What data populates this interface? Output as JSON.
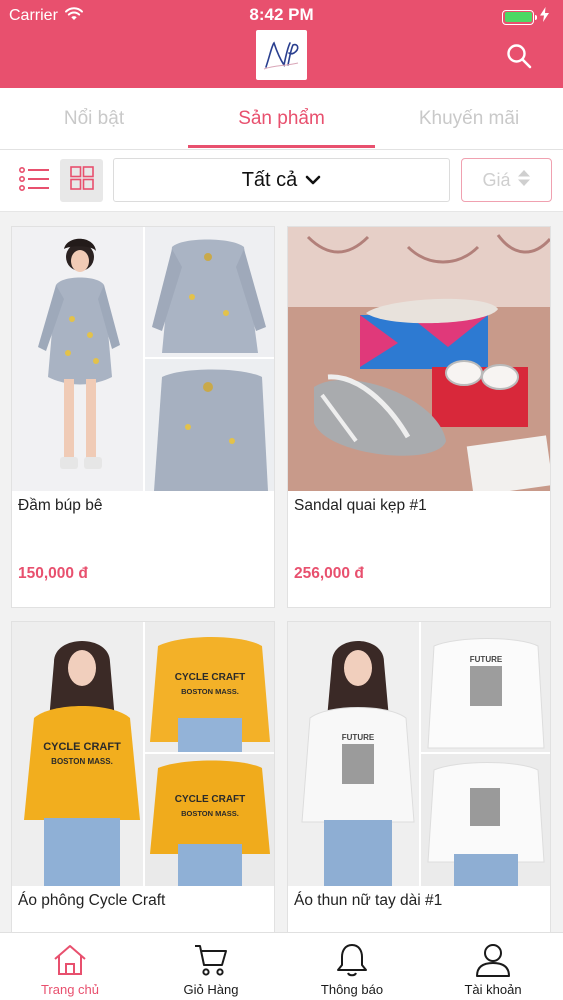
{
  "status_bar": {
    "carrier": "Carrier",
    "time": "8:42 PM"
  },
  "header": {
    "logo_text": "Np",
    "search_icon": "search-icon"
  },
  "tabs": [
    {
      "label": "Nổi bật",
      "active": false
    },
    {
      "label": "Sản phẩm",
      "active": true
    },
    {
      "label": "Khuyến mãi",
      "active": false
    }
  ],
  "toolbar": {
    "list_view_icon": "list-view-icon",
    "grid_view_icon": "grid-view-icon",
    "grid_view_selected": true,
    "filter_value": "Tất cả",
    "price_sort_label": "Giá"
  },
  "products": [
    {
      "name": "Đầm búp bê",
      "price": "150,000 đ"
    },
    {
      "name": "Sandal quai kẹp #1",
      "price": "256,000 đ"
    },
    {
      "name": "Áo phông Cycle Craft",
      "price": ""
    },
    {
      "name": "Áo thun nữ tay dài #1",
      "price": ""
    }
  ],
  "product_image_texts": {
    "cycle_craft_print": "CYCLE CRAFT",
    "boston_print": "BOSTON MASS.",
    "future_print": "FUTURE"
  },
  "bottom_nav": [
    {
      "label": "Trang chủ",
      "icon": "home-icon",
      "active": true
    },
    {
      "label": "Giỏ Hàng",
      "icon": "cart-icon",
      "active": false
    },
    {
      "label": "Thông báo",
      "icon": "bell-icon",
      "active": false
    },
    {
      "label": "Tài khoản",
      "icon": "user-icon",
      "active": false
    }
  ],
  "colors": {
    "brand": "#e8506e",
    "inactive_tab": "#c9c9c9",
    "battery": "#4cd964",
    "background": "#f2f2f2"
  }
}
